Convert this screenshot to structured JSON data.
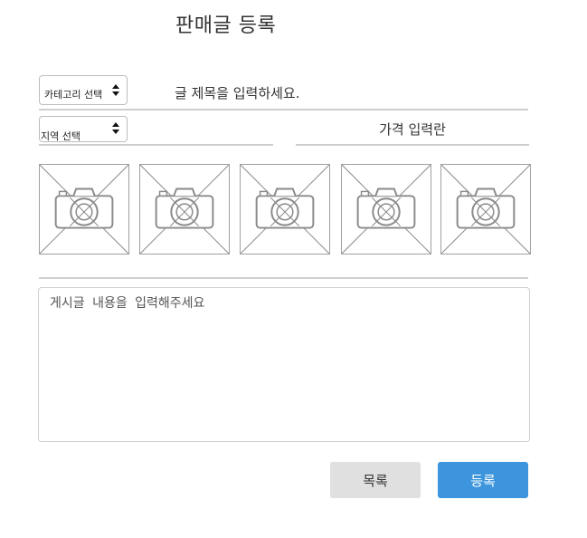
{
  "page": {
    "title": "판매글 등록"
  },
  "form": {
    "category_select": {
      "label": "카테고리 선택",
      "icon": "sort-arrows-icon"
    },
    "region_select": {
      "label": "지역 선택",
      "icon": "sort-arrows-icon"
    },
    "title_input": {
      "placeholder": "글 제목을 입력하세요."
    },
    "price_input": {
      "placeholder": "가격 입력란"
    },
    "photos": [
      {
        "icon": "camera-icon"
      },
      {
        "icon": "camera-icon"
      },
      {
        "icon": "camera-icon"
      },
      {
        "icon": "camera-icon"
      },
      {
        "icon": "camera-icon"
      }
    ],
    "content_textarea": {
      "placeholder": "게시글 내용을 입력해주세요"
    }
  },
  "buttons": {
    "list_label": "목록",
    "submit_label": "등록"
  },
  "colors": {
    "submit_button": "#3d96dd",
    "list_button": "#e0e0e0"
  }
}
